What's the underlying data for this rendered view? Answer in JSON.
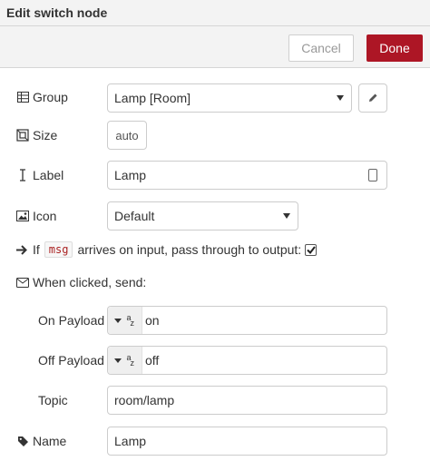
{
  "dialog": {
    "title": "Edit switch node",
    "cancel_label": "Cancel",
    "done_label": "Done"
  },
  "form": {
    "group": {
      "label": "Group",
      "icon": "table-icon",
      "value": "Lamp [Room]"
    },
    "size": {
      "label": "Size",
      "icon": "size-icon",
      "value": "auto"
    },
    "label": {
      "label": "Label",
      "icon": "text-cursor-icon",
      "value": "Lamp"
    },
    "icon": {
      "label": "Icon",
      "icon": "image-icon",
      "value": "Default"
    },
    "pass_through": {
      "prefix": "If",
      "code": "msg",
      "suffix": "arrives on input, pass through to output:",
      "checked": true
    },
    "when_clicked": {
      "label": "When clicked, send:",
      "icon": "envelope-icon"
    },
    "on_payload": {
      "label": "On Payload",
      "type_icon": "string-type-icon",
      "value": "on"
    },
    "off_payload": {
      "label": "Off Payload",
      "type_icon": "string-type-icon",
      "value": "off"
    },
    "topic": {
      "label": "Topic",
      "value": "room/lamp"
    },
    "name": {
      "label": "Name",
      "icon": "tag-icon",
      "value": "Lamp"
    }
  }
}
